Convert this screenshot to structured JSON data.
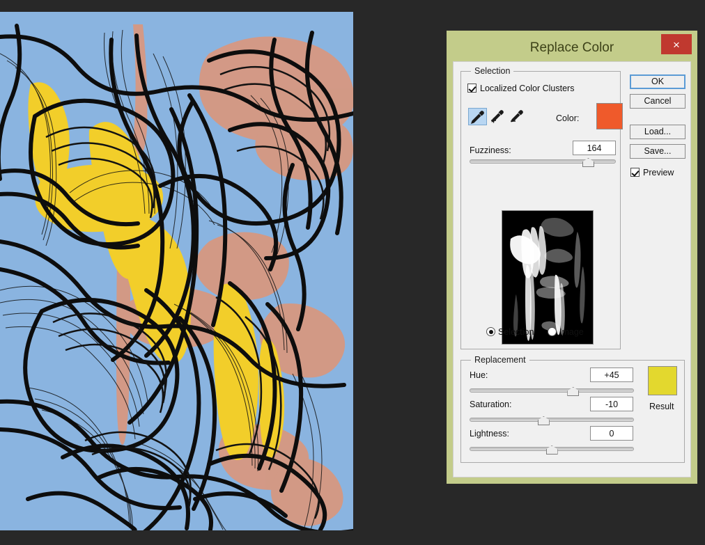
{
  "canvas": {
    "name": "artwork-canvas",
    "description": "Abstract ink-and-wash flower drawing: blue background with yellow petals, salmon washes and flowing black line work",
    "background_color": "#8ab4e0",
    "yellow": "#f2ce2a",
    "salmon": "#d9977e",
    "ink": "#0d0d0d",
    "desktop_color": "#282828"
  },
  "dialog": {
    "title": "Replace Color",
    "titlebar_color": "#c3cc8a",
    "title_text_color": "#3d4218",
    "close_label": "×",
    "close_color": "#c0392f",
    "body_color": "#f0f0f0"
  },
  "selection": {
    "legend": "Selection",
    "localized_clusters": {
      "label": "Localized Color Clusters",
      "checked": true
    },
    "eyedroppers": [
      {
        "name": "eyedropper-icon",
        "mode": "sample",
        "active": true
      },
      {
        "name": "eyedropper-plus-icon",
        "mode": "add",
        "active": false
      },
      {
        "name": "eyedropper-minus-icon",
        "mode": "subtract",
        "active": false
      }
    ],
    "color": {
      "label": "Color:",
      "value": "#ef5a2b"
    },
    "fuzziness": {
      "label": "Fuzziness:",
      "value": "164",
      "slider_percent": 80
    },
    "view_mode": {
      "selection": {
        "label": "Selection",
        "checked": true
      },
      "image": {
        "label": "Image",
        "checked": false
      }
    }
  },
  "replacement": {
    "legend": "Replacement",
    "hue": {
      "label": "Hue:",
      "value": "+45",
      "slider_percent": 62
    },
    "saturation": {
      "label": "Saturation:",
      "value": "-10",
      "slider_percent": 44
    },
    "lightness": {
      "label": "Lightness:",
      "value": "0",
      "slider_percent": 49
    },
    "result": {
      "label": "Result",
      "value": "#e3d82e"
    }
  },
  "buttons": {
    "ok": "OK",
    "cancel": "Cancel",
    "load": "Load...",
    "save": "Save...",
    "preview": {
      "label": "Preview",
      "checked": true
    }
  }
}
